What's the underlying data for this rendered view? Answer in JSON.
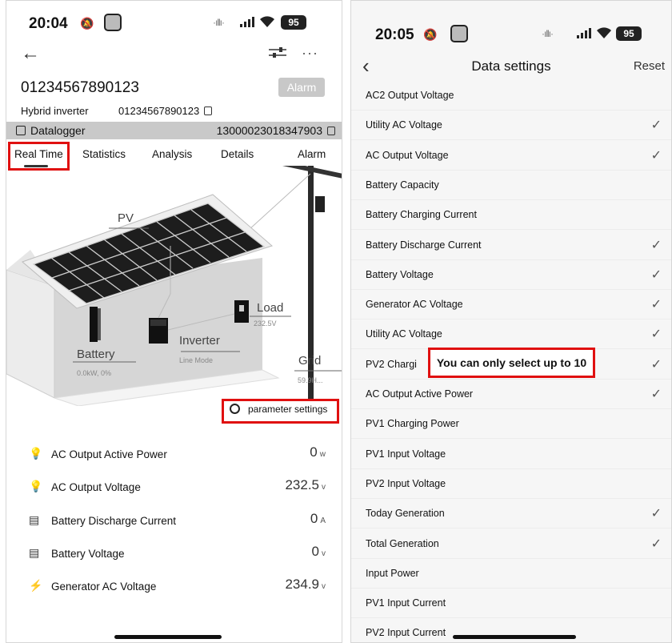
{
  "left": {
    "status": {
      "time": "20:04",
      "battery": "95"
    },
    "device_id": "01234567890123",
    "alarm_button": "Alarm",
    "device_type": "Hybrid inverter",
    "device_sn": "01234567890123",
    "datalogger_label": "Datalogger",
    "datalogger_sn": "13000023018347903",
    "tabs": [
      "Real Time",
      "Statistics",
      "Analysis",
      "Details",
      "Alarm"
    ],
    "scene": {
      "pv": "PV",
      "load": "Load",
      "load_value": "232.5V",
      "inverter": "Inverter",
      "inverter_mode": "Line Mode",
      "battery": "Battery",
      "battery_value": "0.0kW, 0%",
      "grid": "Grid",
      "grid_value": "59.9H..."
    },
    "parameter_settings": "parameter settings",
    "metrics": [
      {
        "name": "AC Output Active Power",
        "value": "0",
        "unit": "w",
        "icon": "lightbulb-icon"
      },
      {
        "name": "AC Output Voltage",
        "value": "232.5",
        "unit": "v",
        "icon": "lightbulb-icon"
      },
      {
        "name": "Battery Discharge Current",
        "value": "0",
        "unit": "A",
        "icon": "battery-icon"
      },
      {
        "name": "Battery Voltage",
        "value": "0",
        "unit": "v",
        "icon": "battery-icon"
      },
      {
        "name": "Generator AC Voltage",
        "value": "234.9",
        "unit": "v",
        "icon": "lightning-icon"
      }
    ]
  },
  "right": {
    "status": {
      "time": "20:05",
      "battery": "95"
    },
    "title": "Data settings",
    "reset": "Reset",
    "items": [
      {
        "label": "AC2 Output Voltage",
        "checked": false
      },
      {
        "label": "Utility AC Voltage",
        "checked": true
      },
      {
        "label": "AC Output Voltage",
        "checked": true
      },
      {
        "label": "Battery Capacity",
        "checked": false
      },
      {
        "label": "Battery Charging Current",
        "checked": false
      },
      {
        "label": "Battery Discharge Current",
        "checked": true
      },
      {
        "label": "Battery Voltage",
        "checked": true
      },
      {
        "label": "Generator AC Voltage",
        "checked": true
      },
      {
        "label": "Utility AC Voltage",
        "checked": true
      },
      {
        "label": "PV2 Chargi",
        "checked": true
      },
      {
        "label": "AC Output Active Power",
        "checked": true
      },
      {
        "label": "PV1 Charging Power",
        "checked": false
      },
      {
        "label": "PV1 Input Voltage",
        "checked": false
      },
      {
        "label": "PV2 Input Voltage",
        "checked": false
      },
      {
        "label": "Today Generation",
        "checked": true
      },
      {
        "label": "Total Generation",
        "checked": true
      },
      {
        "label": "Input Power",
        "checked": false
      },
      {
        "label": "PV1 Input Current",
        "checked": false
      },
      {
        "label": "PV2 Input Current",
        "checked": false
      }
    ],
    "toast": "You can only select up to 10",
    "check_glyph": "✓"
  },
  "colors": {
    "highlight": "#e01010",
    "bar_gray": "#c9c9c9"
  }
}
